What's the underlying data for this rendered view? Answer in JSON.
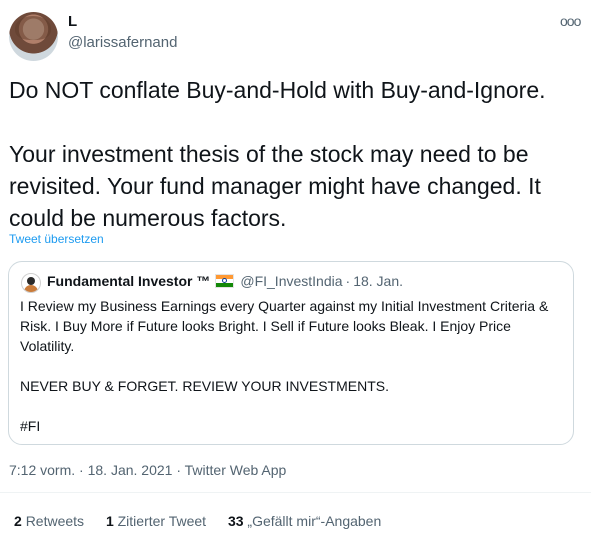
{
  "author": {
    "name": "L",
    "handle": "@larissafernand"
  },
  "menu": {
    "icon": "more-horizontal-icon",
    "glyph": "ooo"
  },
  "tweet": {
    "text": "Do NOT conflate Buy-and-Hold with Buy-and-Ignore.\n\nYour investment thesis of the stock may need to be revisited. Your fund manager might have changed. It could be numerous factors.",
    "translate_label": "Tweet übersetzen"
  },
  "quoted": {
    "name": "Fundamental Investor ™",
    "flag": "india-flag-icon",
    "handle": "@FI_InvestIndia",
    "separator": "·",
    "date": "18. Jan.",
    "text": "I Review my Business Earnings every Quarter against my Initial Investment Criteria & Risk. I Buy More if Future looks Bright. I Sell if Future looks Bleak. I Enjoy Price Volatility.\n\nNEVER BUY & FORGET. REVIEW YOUR INVESTMENTS.\n\n#FI"
  },
  "meta": {
    "time": "7:12 vorm.",
    "separator": "·",
    "date": "18. Jan. 2021",
    "app": "Twitter Web App"
  },
  "stats": {
    "retweets": {
      "count": "2",
      "label": "Retweets"
    },
    "quotes": {
      "count": "1",
      "label": "Zitierter Tweet"
    },
    "likes": {
      "count": "33",
      "label": "„Gefällt mir“-Angaben"
    }
  }
}
